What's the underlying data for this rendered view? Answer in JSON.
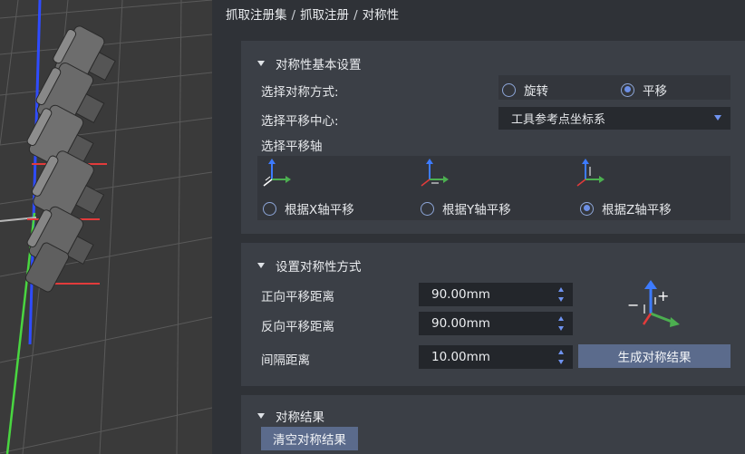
{
  "colors": {
    "viewport_bg": "#3a3a3a",
    "panel_bg": "#2f3237",
    "section_bg": "#3b3f46",
    "accent": "#6c8fe6",
    "button_bg": "#5b6b8c",
    "axis_x": "#4caf50",
    "axis_y": "#3d7bff",
    "axis_z": "#e23b3b"
  },
  "breadcrumb": [
    "抓取注册集",
    "抓取注册",
    "对称性"
  ],
  "breadcrumb_separator": "/",
  "basic_settings": {
    "title": "对称性基本设置",
    "symmetry_mode_label": "选择对称方式:",
    "mode_options": [
      {
        "label": "旋转",
        "selected": false
      },
      {
        "label": "平移",
        "selected": true
      }
    ],
    "center_label": "选择平移中心:",
    "center_value": "工具参考点坐标系",
    "axis_label": "选择平移轴",
    "axis_options": [
      {
        "label": "根据X轴平移",
        "selected": false,
        "icon": "xyz-axis-x-translate-icon"
      },
      {
        "label": "根据Y轴平移",
        "selected": false,
        "icon": "xyz-axis-y-translate-icon"
      },
      {
        "label": "根据Z轴平移",
        "selected": true,
        "icon": "xyz-axis-z-translate-icon"
      }
    ]
  },
  "method": {
    "title": "设置对称性方式",
    "forward_label": "正向平移距离",
    "forward_value": "90.00mm",
    "reverse_label": "反向平移距离",
    "reverse_value": "90.00mm",
    "interval_label": "间隔距离",
    "interval_value": "10.00mm",
    "generate_button": "生成对称结果",
    "diagram_minus": "−",
    "diagram_plus": "+"
  },
  "results": {
    "title": "对称结果",
    "clear_button": "清空对称结果"
  }
}
